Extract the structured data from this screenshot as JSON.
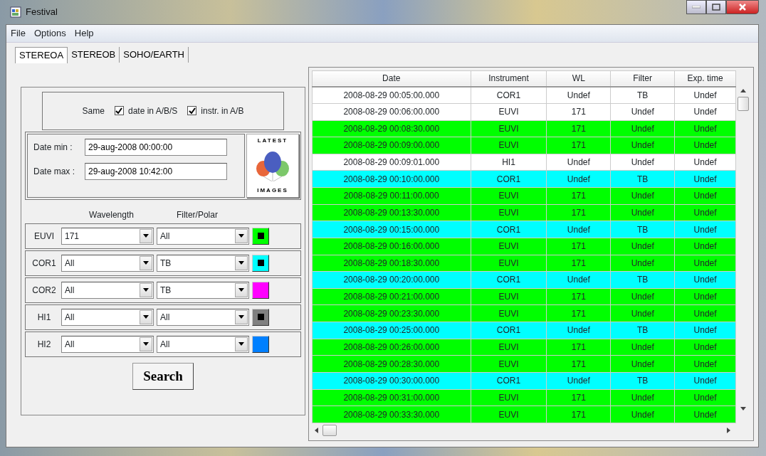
{
  "window": {
    "title": "Festival"
  },
  "menu": [
    "File",
    "Options",
    "Help"
  ],
  "tabs": [
    {
      "label": "STEREOA",
      "selected": true
    },
    {
      "label": "STEREOB",
      "selected": false
    },
    {
      "label": "SOHO/EARTH",
      "selected": false
    }
  ],
  "same": {
    "label": "Same",
    "options": [
      {
        "label": "date in A/B/S",
        "checked": true
      },
      {
        "label": "instr. in A/B",
        "checked": true
      }
    ]
  },
  "dates": [
    {
      "label": "Date min :",
      "value": "29-aug-2008 00:00:00"
    },
    {
      "label": "Date max :",
      "value": "29-aug-2008 10:42:00"
    }
  ],
  "latest_images": {
    "top": "LATEST",
    "bottom": "IMAGES"
  },
  "instrument_headers": [
    "Wavelength",
    "Filter/Polar"
  ],
  "instruments": [
    {
      "name": "EUVI",
      "wavelength": "171",
      "filter": "All",
      "color": "#00ff00",
      "checked": true
    },
    {
      "name": "COR1",
      "wavelength": "All",
      "filter": "TB",
      "color": "#00ffff",
      "checked": true
    },
    {
      "name": "COR2",
      "wavelength": "All",
      "filter": "TB",
      "color": "#ff00ff",
      "checked": false
    },
    {
      "name": "HI1",
      "wavelength": "All",
      "filter": "All",
      "color": "#808080",
      "checked": true
    },
    {
      "name": "HI2",
      "wavelength": "All",
      "filter": "All",
      "color": "#0080ff",
      "checked": false
    }
  ],
  "search_button": "Search",
  "table": {
    "columns": [
      "Date",
      "Instrument",
      "WL",
      "Filter",
      "Exp. time"
    ],
    "rows": [
      {
        "cells": [
          "2008-08-29 00:05:00.000",
          "COR1",
          "Undef",
          "TB",
          "Undef"
        ],
        "color": "#ffffff"
      },
      {
        "cells": [
          "2008-08-29 00:06:00.000",
          "EUVI",
          "171",
          "Undef",
          "Undef"
        ],
        "color": "#ffffff"
      },
      {
        "cells": [
          "2008-08-29 00:08:30.000",
          "EUVI",
          "171",
          "Undef",
          "Undef"
        ],
        "color": "#00ff00"
      },
      {
        "cells": [
          "2008-08-29 00:09:00.000",
          "EUVI",
          "171",
          "Undef",
          "Undef"
        ],
        "color": "#00ff00"
      },
      {
        "cells": [
          "2008-08-29 00:09:01.000",
          "HI1",
          "Undef",
          "Undef",
          "Undef"
        ],
        "color": "#ffffff"
      },
      {
        "cells": [
          "2008-08-29 00:10:00.000",
          "COR1",
          "Undef",
          "TB",
          "Undef"
        ],
        "color": "#00ffff"
      },
      {
        "cells": [
          "2008-08-29 00:11:00.000",
          "EUVI",
          "171",
          "Undef",
          "Undef"
        ],
        "color": "#00ff00"
      },
      {
        "cells": [
          "2008-08-29 00:13:30.000",
          "EUVI",
          "171",
          "Undef",
          "Undef"
        ],
        "color": "#00ff00"
      },
      {
        "cells": [
          "2008-08-29 00:15:00.000",
          "COR1",
          "Undef",
          "TB",
          "Undef"
        ],
        "color": "#00ffff"
      },
      {
        "cells": [
          "2008-08-29 00:16:00.000",
          "EUVI",
          "171",
          "Undef",
          "Undef"
        ],
        "color": "#00ff00"
      },
      {
        "cells": [
          "2008-08-29 00:18:30.000",
          "EUVI",
          "171",
          "Undef",
          "Undef"
        ],
        "color": "#00ff00"
      },
      {
        "cells": [
          "2008-08-29 00:20:00.000",
          "COR1",
          "Undef",
          "TB",
          "Undef"
        ],
        "color": "#00ffff"
      },
      {
        "cells": [
          "2008-08-29 00:21:00.000",
          "EUVI",
          "171",
          "Undef",
          "Undef"
        ],
        "color": "#00ff00"
      },
      {
        "cells": [
          "2008-08-29 00:23:30.000",
          "EUVI",
          "171",
          "Undef",
          "Undef"
        ],
        "color": "#00ff00"
      },
      {
        "cells": [
          "2008-08-29 00:25:00.000",
          "COR1",
          "Undef",
          "TB",
          "Undef"
        ],
        "color": "#00ffff"
      },
      {
        "cells": [
          "2008-08-29 00:26:00.000",
          "EUVI",
          "171",
          "Undef",
          "Undef"
        ],
        "color": "#00ff00"
      },
      {
        "cells": [
          "2008-08-29 00:28:30.000",
          "EUVI",
          "171",
          "Undef",
          "Undef"
        ],
        "color": "#00ff00"
      },
      {
        "cells": [
          "2008-08-29 00:30:00.000",
          "COR1",
          "Undef",
          "TB",
          "Undef"
        ],
        "color": "#00ffff"
      },
      {
        "cells": [
          "2008-08-29 00:31:00.000",
          "EUVI",
          "171",
          "Undef",
          "Undef"
        ],
        "color": "#00ff00"
      },
      {
        "cells": [
          "2008-08-29 00:33:30.000",
          "EUVI",
          "171",
          "Undef",
          "Undef"
        ],
        "color": "#00ff00"
      }
    ]
  }
}
